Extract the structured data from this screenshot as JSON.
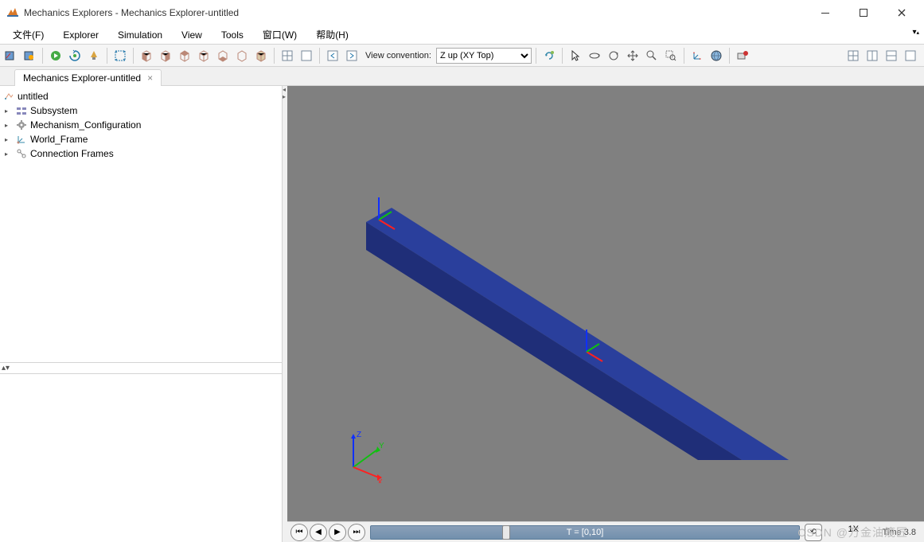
{
  "window": {
    "title": "Mechanics Explorers - Mechanics Explorer-untitled"
  },
  "menubar": {
    "file": "文件(F)",
    "explorer": "Explorer",
    "simulation": "Simulation",
    "view": "View",
    "tools": "Tools",
    "window": "窗口(W)",
    "help": "帮助(H)"
  },
  "toolbar": {
    "view_convention_label": "View convention:",
    "view_convention_value": "Z up (XY Top)"
  },
  "tab": {
    "label": "Mechanics Explorer-untitled"
  },
  "tree": {
    "root": "untitled",
    "items": [
      "Subsystem",
      "Mechanism_Configuration",
      "World_Frame",
      "Connection Frames"
    ]
  },
  "playback": {
    "time_range": "T = [0,10]",
    "speed": "1X",
    "time": "Time   3.8"
  },
  "viewport": {
    "axis_z": "Z",
    "axis_y": "Y",
    "axis_x": "X"
  },
  "watermark": "CSDN @万金油篾匠"
}
